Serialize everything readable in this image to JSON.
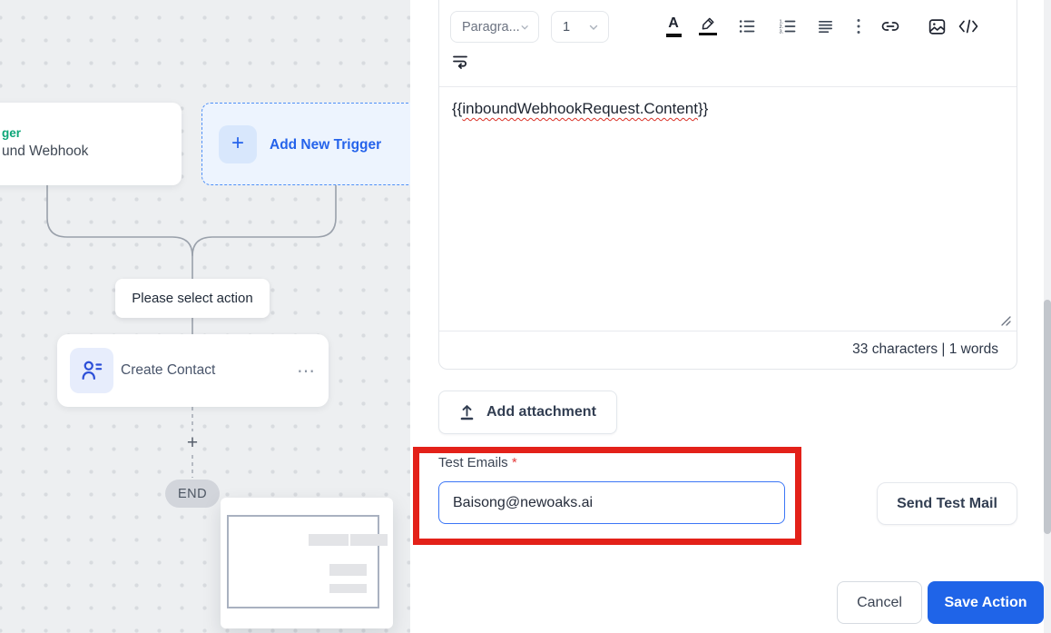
{
  "colors": {
    "accent_blue": "#2563eb",
    "save_button_blue": "#1f64e8",
    "annotation_red": "#e32119",
    "trigger_green": "#0ca678",
    "canvas_background": "#edeff1",
    "input_border_blue": "#3b76f6"
  },
  "canvas": {
    "trigger_card": {
      "line1_fragment": "ger",
      "line2_fragment": "und Webhook"
    },
    "add_trigger": {
      "plus": "+",
      "label": "Add New Trigger"
    },
    "select_action_label": "Please select action",
    "action_card": {
      "label": "Create Contact",
      "menu_glyph": "⋯"
    },
    "add_step_plus": "+",
    "end_label": "END"
  },
  "editor": {
    "toolbar": {
      "paragraph_value": "Paragra...",
      "font_size_value": "1",
      "text_color_glyph": "A",
      "icons": [
        "text-color",
        "highlight",
        "bullet-list",
        "ordered-list",
        "align-justify",
        "more-options",
        "link",
        "image",
        "code",
        "text-wrap"
      ]
    },
    "content": {
      "open_braces": "{{",
      "variable": "inboundWebhookRequest.Content",
      "close_braces": "}}"
    },
    "stats": "33 characters | 1 words"
  },
  "attachment": {
    "label": "Add attachment",
    "icon": "upload-icon"
  },
  "test_emails": {
    "label": "Test Emails",
    "required_mark": "*",
    "value": "Baisong@newoaks.ai"
  },
  "actions": {
    "send_test": "Send Test Mail",
    "cancel": "Cancel",
    "save": "Save Action"
  }
}
